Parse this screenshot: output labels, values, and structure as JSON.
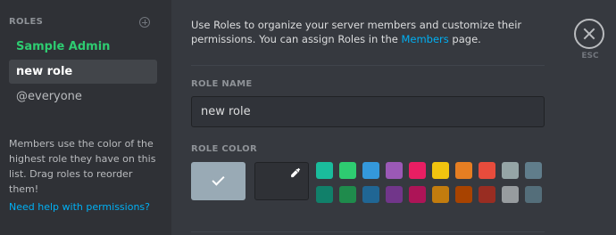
{
  "sidebar": {
    "title": "ROLES",
    "roles": [
      {
        "label": "Sample Admin",
        "color": "#2ecc71"
      },
      {
        "label": "new role",
        "selected": true
      },
      {
        "label": "@everyone"
      }
    ],
    "help_text": "Members use the color of the highest role they have on this list. Drag roles to reorder them!",
    "help_link": "Need help with permissions?"
  },
  "main": {
    "description_prefix": "Use Roles to organize your server members and customize their permissions. You can assign Roles in the ",
    "description_link": "Members",
    "description_suffix": " page.",
    "close_label": "ESC",
    "role_name_label": "ROLE NAME",
    "role_name_value": "new role",
    "role_color_label": "ROLE COLOR",
    "default_color": "#99aab5",
    "swatches_row1": [
      "#1abc9c",
      "#2ecc71",
      "#3498db",
      "#9b59b6",
      "#e91e63",
      "#f1c40f",
      "#e67e22",
      "#e74c3c",
      "#95a5a6",
      "#607d8b"
    ],
    "swatches_row2": [
      "#11806a",
      "#1f8b4c",
      "#206694",
      "#71368a",
      "#ad1457",
      "#c27c0e",
      "#a84300",
      "#992d22",
      "#979c9f",
      "#546e7a"
    ]
  }
}
